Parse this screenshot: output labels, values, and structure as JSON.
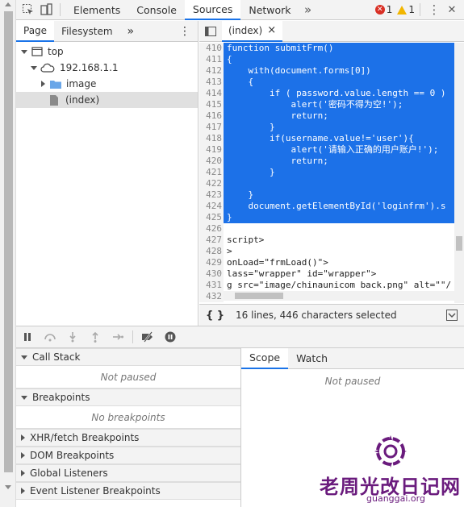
{
  "toolbar": {
    "tabs": [
      "Elements",
      "Console",
      "Sources",
      "Network"
    ],
    "active_tab": "Sources",
    "more": "»",
    "errors": "1",
    "warnings": "1",
    "menu_icon": "⋮",
    "close_icon": "✕"
  },
  "navigator": {
    "tabs": [
      "Page",
      "Filesystem"
    ],
    "more": "»",
    "menu": "⋮",
    "tree": {
      "top": "top",
      "host": "192.168.1.1",
      "folder": "image",
      "file": "(index)"
    }
  },
  "editor": {
    "tab_label": "(index)",
    "tab_close": "×",
    "lines": [
      {
        "n": "410",
        "t": "function submitFrm()",
        "sel": true
      },
      {
        "n": "411",
        "t": "{",
        "sel": true
      },
      {
        "n": "412",
        "t": "    with(document.forms[0])",
        "sel": true
      },
      {
        "n": "413",
        "t": "    {",
        "sel": true
      },
      {
        "n": "414",
        "t": "        if ( password.value.length == 0 )",
        "sel": true
      },
      {
        "n": "415",
        "t": "            alert('密码不得为空!');",
        "sel": true
      },
      {
        "n": "416",
        "t": "            return;",
        "sel": true
      },
      {
        "n": "417",
        "t": "        }",
        "sel": true
      },
      {
        "n": "418",
        "t": "        if(username.value!='user'){",
        "sel": true
      },
      {
        "n": "419",
        "t": "            alert('请输入正确的用户账户!');",
        "sel": true
      },
      {
        "n": "420",
        "t": "            return;",
        "sel": true
      },
      {
        "n": "421",
        "t": "        }",
        "sel": true
      },
      {
        "n": "422",
        "t": "",
        "sel": true
      },
      {
        "n": "423",
        "t": "    }",
        "sel": true
      },
      {
        "n": "424",
        "t": "    document.getElementById('loginfrm').s",
        "sel": true
      },
      {
        "n": "425",
        "t": "}",
        "sel": true
      },
      {
        "n": "426",
        "t": "",
        "sel": false
      },
      {
        "n": "427",
        "t": "script>",
        "sel": false
      },
      {
        "n": "428",
        "t": ">",
        "sel": false
      },
      {
        "n": "429",
        "t": "onLoad=\"frmLoad()\">",
        "sel": false
      },
      {
        "n": "430",
        "t": "lass=\"wrapper\" id=\"wrapper\">",
        "sel": false
      },
      {
        "n": "431",
        "t": "g src=\"image/chinaunicom back.png\" alt=\"\"/",
        "sel": false
      },
      {
        "n": "432",
        "t": "",
        "sel": false
      }
    ],
    "status": "16 lines, 446 characters selected",
    "format_icon": "{ }"
  },
  "debugger": {
    "sections": [
      {
        "title": "Call Stack",
        "body": "Not paused",
        "expanded": true
      },
      {
        "title": "Breakpoints",
        "body": "No breakpoints",
        "expanded": true
      },
      {
        "title": "XHR/fetch Breakpoints",
        "expanded": false
      },
      {
        "title": "DOM Breakpoints",
        "expanded": false
      },
      {
        "title": "Global Listeners",
        "expanded": false
      },
      {
        "title": "Event Listener Breakpoints",
        "expanded": false
      }
    ],
    "right_tabs": [
      "Scope",
      "Watch"
    ],
    "right_body": "Not paused"
  },
  "watermark": {
    "text": "老周光改日记网",
    "url": "guanggai.org"
  },
  "colors": {
    "selection": "#1c71e8",
    "accent": "#1a73e8",
    "error": "#d93025",
    "warning": "#f2b600",
    "watermark": "#6a1b7d"
  }
}
